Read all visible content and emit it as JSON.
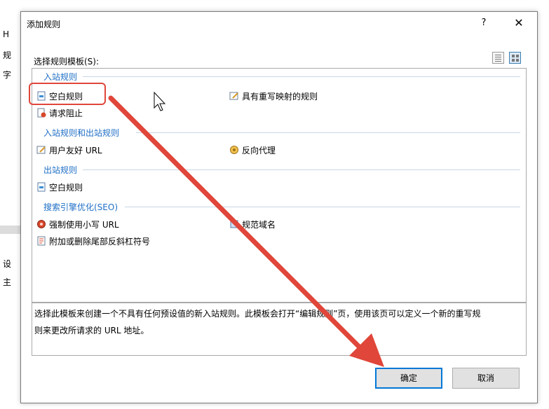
{
  "background": {
    "letters": [
      "H",
      "规",
      "字",
      "设",
      "主"
    ]
  },
  "dialog": {
    "title": "添加规则",
    "help_label": "?",
    "close_label": "✕",
    "template_label": "选择规则模板(S):",
    "groups": [
      {
        "header": "入站规则",
        "items": [
          {
            "label": "空白规则",
            "icon": "blank-rule-icon"
          },
          {
            "label": "具有重写映射的规则",
            "icon": "rewrite-map-rule-icon"
          },
          {
            "label": "请求阻止",
            "icon": "request-block-icon"
          }
        ]
      },
      {
        "header": "入站规则和出站规则",
        "items": [
          {
            "label": "用户友好 URL",
            "icon": "friendly-url-icon"
          },
          {
            "label": "反向代理",
            "icon": "reverse-proxy-icon"
          }
        ]
      },
      {
        "header": "出站规则",
        "items": [
          {
            "label": "空白规则",
            "icon": "outbound-blank-rule-icon"
          }
        ]
      },
      {
        "header": "搜索引擎优化(SEO)",
        "items": [
          {
            "label": "强制使用小写 URL",
            "icon": "lowercase-url-icon"
          },
          {
            "label": "规范域名",
            "icon": "canonical-domain-icon"
          },
          {
            "label": "附加或删除尾部反斜杠符号",
            "icon": "trailing-slash-icon"
          }
        ]
      }
    ],
    "description_line1": "选择此模板来创建一个不具有任何预设值的新入站规则。此模板会打开“编辑规则”页，使用该页可以定义一个新的重写规",
    "description_line2": "则来更改所请求的 URL 地址。",
    "ok_label": "确定",
    "cancel_label": "取消"
  },
  "colors": {
    "group_header": "#1f6fc5",
    "annotation": "#e0463a",
    "focus": "#0078d7"
  }
}
